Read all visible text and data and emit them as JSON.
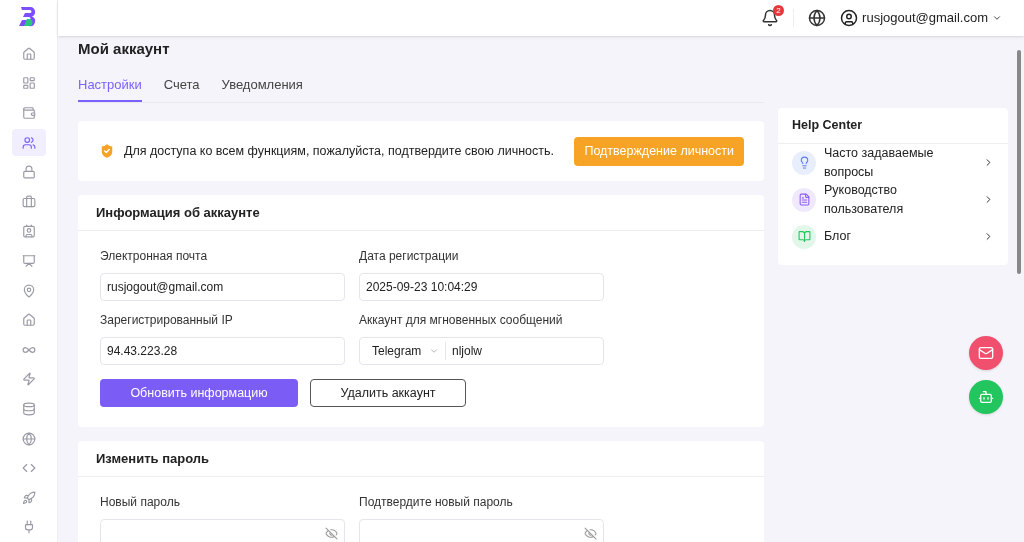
{
  "header": {
    "notifications_badge": "2",
    "user": "rusjogout@gmail.com"
  },
  "sidebar": {
    "items": [
      {
        "selected": false
      },
      {
        "selected": false
      },
      {
        "selected": false
      },
      {
        "selected": true
      },
      {
        "selected": false
      },
      {
        "selected": false
      },
      {
        "selected": false
      },
      {
        "selected": false
      },
      {
        "selected": false
      },
      {
        "selected": false
      },
      {
        "selected": false
      },
      {
        "selected": false
      },
      {
        "selected": false
      },
      {
        "selected": false
      },
      {
        "selected": false
      },
      {
        "selected": false
      },
      {
        "selected": false
      }
    ]
  },
  "page_title": "Мой аккаунт",
  "tabs": [
    {
      "label": "Настройки",
      "selected": true
    },
    {
      "label": "Счета",
      "selected": false
    },
    {
      "label": "Уведомления",
      "selected": false
    }
  ],
  "verify_banner": {
    "text": "Для доступа ко всем функциям, пожалуйста, подтвердите свою личность.",
    "button": "Подтверждение личности"
  },
  "account_info": {
    "title": "Информация об аккаунте",
    "fields": [
      {
        "label": "Электронная почта",
        "value": "rusjogout@gmail.com"
      },
      {
        "label": "Дата регистрации",
        "value": "2025-09-23 10:04:29"
      },
      {
        "label": "Зарегистрированный IP",
        "value": "94.43.223.28"
      }
    ],
    "messenger": {
      "label": "Аккаунт для мгновенных сообщений",
      "type": "Telegram",
      "value": "nljolw"
    },
    "buttons": [
      "Обновить информацию",
      "Удалить аккаунт"
    ]
  },
  "change_password": {
    "title": "Изменить пароль",
    "fields": [
      {
        "label": "Новый пароль"
      },
      {
        "label": "Подтвердите новый пароль"
      }
    ]
  },
  "help_center": {
    "title": "Help Center",
    "items": [
      {
        "label": "Часто задаваемые вопросы",
        "color": "#5b7cf0"
      },
      {
        "label": "Руководство пользователя",
        "color": "#8b5cf6"
      },
      {
        "label": "Блог",
        "color": "#22c55e"
      }
    ]
  }
}
